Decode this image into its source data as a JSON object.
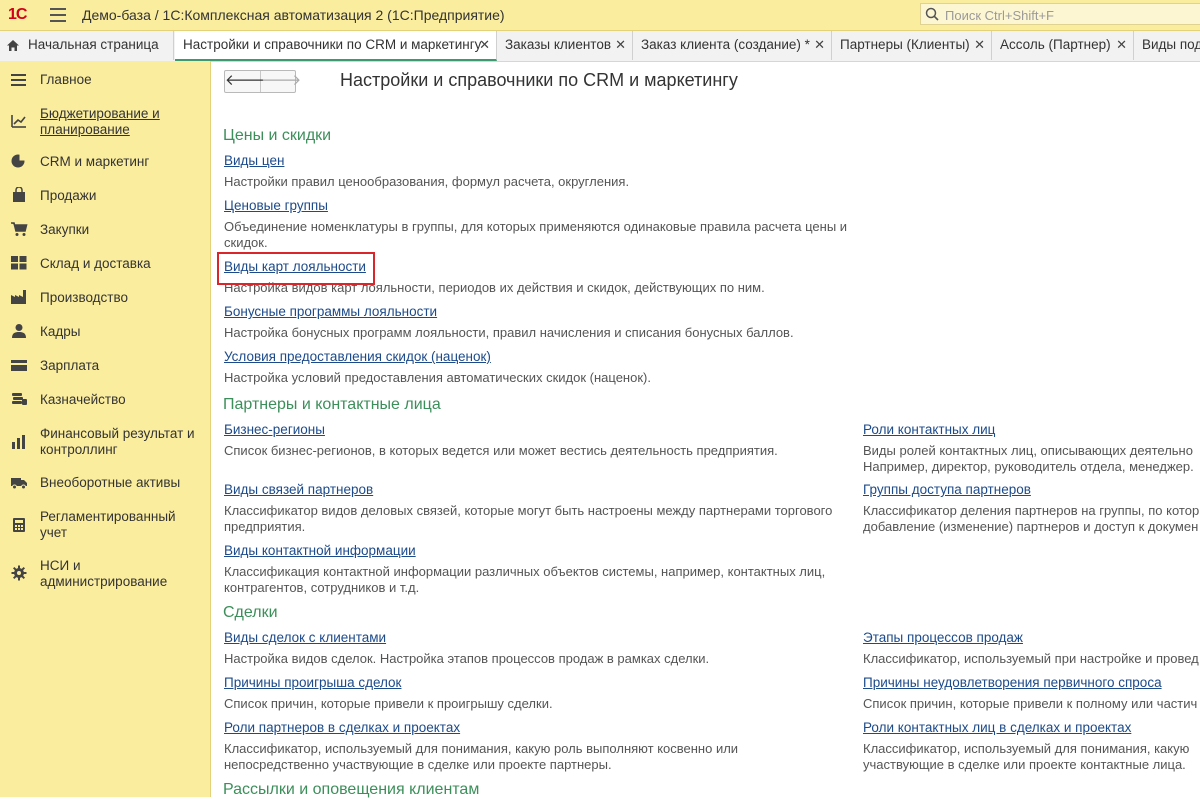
{
  "titlebar": {
    "logo": "1С",
    "title": "Демо-база / 1С:Комплексная автоматизация 2  (1С:Предприятие)",
    "search_placeholder": "Поиск Ctrl+Shift+F"
  },
  "tabs": [
    {
      "label": "Начальная страница"
    },
    {
      "label": "Настройки и справочники по CRM и маркетингу",
      "close": "✕",
      "active": true
    },
    {
      "label": "Заказы клиентов",
      "close": "✕"
    },
    {
      "label": "Заказ клиента (создание) *",
      "close": "✕"
    },
    {
      "label": "Партнеры (Клиенты)",
      "close": "✕"
    },
    {
      "label": "Ассоль (Партнер)",
      "close": "✕"
    },
    {
      "label": "Виды поди"
    }
  ],
  "sidebar": {
    "items": [
      {
        "label": "Главное",
        "icon": "list-icon"
      },
      {
        "label": "Бюджетирование и планирование",
        "icon": "budget-chart-icon"
      },
      {
        "label": "CRM и маркетинг",
        "icon": "pie-chart-icon"
      },
      {
        "label": "Продажи",
        "icon": "shopping-bag-icon"
      },
      {
        "label": "Закупки",
        "icon": "cart-icon"
      },
      {
        "label": "Склад и доставка",
        "icon": "warehouse-icon"
      },
      {
        "label": "Производство",
        "icon": "factory-icon"
      },
      {
        "label": "Кадры",
        "icon": "person-icon"
      },
      {
        "label": "Зарплата",
        "icon": "wallet-icon"
      },
      {
        "label": "Казначейство",
        "icon": "coins-icon"
      },
      {
        "label": "Финансовый результат и контроллинг",
        "icon": "bar-chart-icon"
      },
      {
        "label": "Внеоборотные активы",
        "icon": "truck-icon"
      },
      {
        "label": "Регламентированный учет",
        "icon": "calculator-icon"
      },
      {
        "label": "НСИ и администрирование",
        "icon": "gear-icon"
      }
    ]
  },
  "page": {
    "title": "Настройки и справочники по CRM и маркетингу",
    "back": "🡐",
    "forward": "🡒"
  },
  "sections": {
    "prices": {
      "title": "Цены и скидки",
      "items": [
        {
          "link": "Виды цен",
          "desc": "Настройки правил ценообразования, формул расчета, округления."
        },
        {
          "link": "Ценовые группы",
          "desc": "Объединение номенклатуры в группы, для которых применяются одинаковые правила расчета цены и скидок."
        },
        {
          "link": "Виды карт лояльности",
          "desc": "Настройка видов карт лояльности, периодов их действия и скидок, действующих по ним."
        },
        {
          "link": "Бонусные программы лояльности",
          "desc": "Настройка бонусных программ лояльности, правил начисления и списания бонусных баллов."
        },
        {
          "link": "Условия предоставления скидок (наценок)",
          "desc": "Настройка условий предоставления автоматических скидок (наценок)."
        }
      ]
    },
    "partners": {
      "title": "Партнеры и контактные лица",
      "left": [
        {
          "link": "Бизнес-регионы",
          "desc": "Список бизнес-регионов, в которых ведется или может вестись деятельность предприятия."
        },
        {
          "link": "Виды связей партнеров",
          "desc": "Классификатор видов деловых связей, которые могут быть настроены между партнерами торгового предприятия."
        },
        {
          "link": "Виды контактной информации",
          "desc": "Классификация контактной информации различных объектов системы, например, контактных лиц, контрагентов, сотрудников и т.д."
        }
      ],
      "right": [
        {
          "link": "Роли контактных лиц",
          "desc1": "Виды ролей контактных лиц, описывающих деятельно",
          "desc2": "Например, директор, руководитель отдела, менеджер."
        },
        {
          "link": "Группы доступа партнеров",
          "desc1": "Классификатор деления партнеров на группы, по котор",
          "desc2": "добавление (изменение) партнеров и доступ к докумен"
        }
      ]
    },
    "deals": {
      "title": "Сделки",
      "left": [
        {
          "link": "Виды сделок с клиентами",
          "desc": "Настройка видов сделок. Настройка этапов процессов продаж в рамках сделки."
        },
        {
          "link": "Причины проигрыша сделок",
          "desc": "Список причин, которые привели к проигрышу сделки."
        },
        {
          "link": "Роли партнеров в сделках и проектах",
          "desc": "Классификатор, используемый для понимания, какую роль выполняют косвенно или непосредственно участвующие в сделке или проекте партнеры."
        }
      ],
      "right": [
        {
          "link": "Этапы процессов продаж",
          "desc1": "Классификатор, используемый при настройке и провед"
        },
        {
          "link": "Причины неудовлетворения первичного спроса",
          "desc1": "Список причин, которые привели к полному или частич"
        },
        {
          "link": "Роли контактных лиц в сделках и проектах",
          "desc1": "Классификатор, используемый для понимания, какую",
          "desc2": "участвующие в сделке или проекте контактные лица."
        }
      ]
    },
    "mailing": {
      "title": "Рассылки и оповещения клиентам"
    }
  },
  "colors": {
    "sidebar_bg": "#fbed9e",
    "section_title": "#3c8f5a",
    "link": "#1c4a8a",
    "highlight_box": "#d9262b"
  }
}
